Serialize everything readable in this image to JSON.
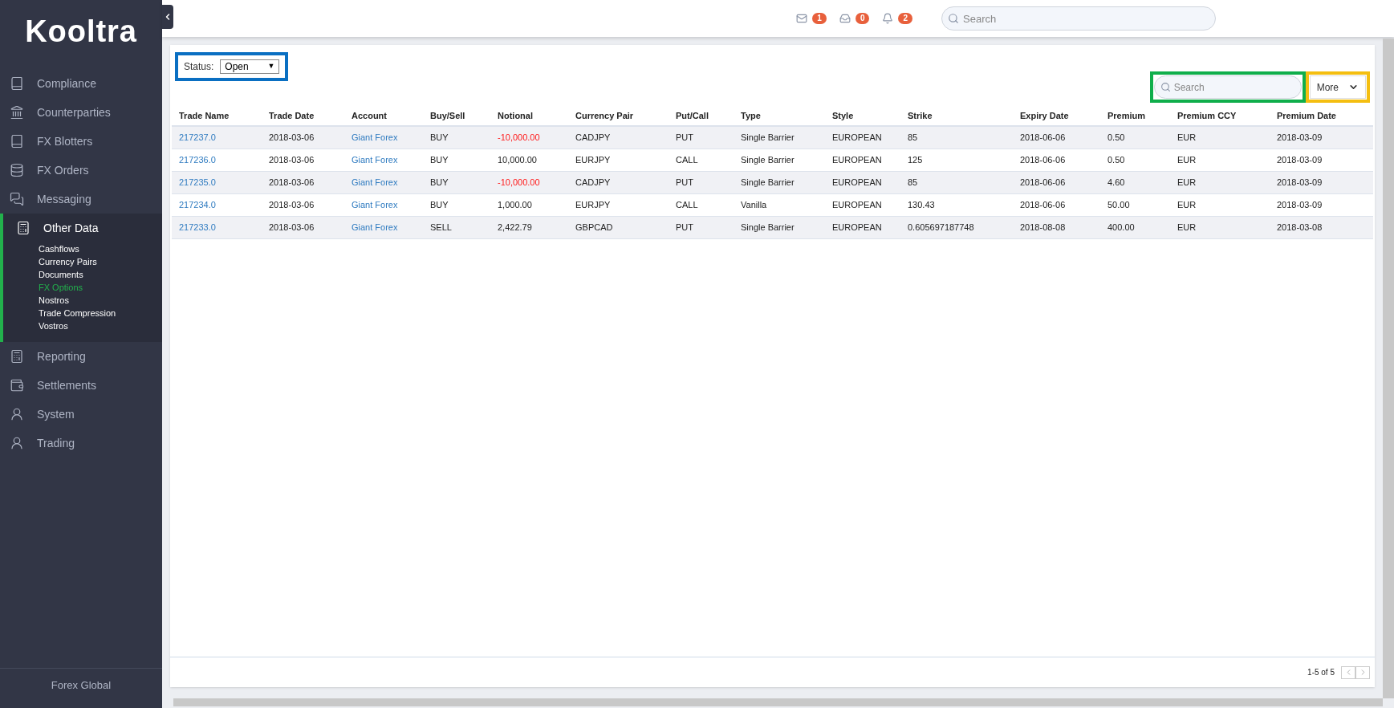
{
  "sidebar": {
    "logo": "Kooltra",
    "items": [
      {
        "label": "Compliance",
        "selected": false
      },
      {
        "label": "Counterparties",
        "selected": false
      },
      {
        "label": "FX Blotters",
        "selected": false
      },
      {
        "label": "FX Orders",
        "selected": false
      },
      {
        "label": "Messaging",
        "selected": false
      },
      {
        "label": "Other Data",
        "selected": true,
        "expanded": true,
        "children": [
          {
            "label": "Cashflows",
            "selected": false
          },
          {
            "label": "Currency Pairs",
            "selected": false
          },
          {
            "label": "Documents",
            "selected": false
          },
          {
            "label": "FX Options",
            "selected": true
          },
          {
            "label": "Nostros",
            "selected": false
          },
          {
            "label": "Trade Compression",
            "selected": false
          },
          {
            "label": "Vostros",
            "selected": false
          }
        ]
      },
      {
        "label": "Reporting",
        "selected": false
      },
      {
        "label": "Settlements",
        "selected": false
      },
      {
        "label": "System",
        "selected": false
      },
      {
        "label": "Trading",
        "selected": false
      }
    ],
    "footer": "Forex Global"
  },
  "topbar": {
    "notifications": [
      {
        "count": "1"
      },
      {
        "count": "0"
      },
      {
        "count": "2"
      }
    ],
    "search": {
      "placeholder": "Search"
    }
  },
  "filter": {
    "label": "Status:",
    "value": "Open",
    "arrow": "▼"
  },
  "table_search": {
    "placeholder": "Search"
  },
  "more_button": "More",
  "table": {
    "columns": [
      "Trade Name",
      "Trade Date",
      "Account",
      "Buy/Sell",
      "Notional",
      "Currency Pair",
      "Put/Call",
      "Type",
      "Style",
      "Strike",
      "Expiry Date",
      "Premium",
      "Premium CCY",
      "Premium Date"
    ],
    "rows": [
      [
        {
          "text": "217237.0",
          "kind": "link"
        },
        {
          "text": "2018-03-06",
          "kind": "text"
        },
        {
          "text": "Giant Forex",
          "kind": "link"
        },
        {
          "text": "BUY",
          "kind": "text"
        },
        {
          "text": "-10,000.00",
          "kind": "negative"
        },
        {
          "text": "CADJPY",
          "kind": "text"
        },
        {
          "text": "PUT",
          "kind": "text"
        },
        {
          "text": "Single Barrier",
          "kind": "text"
        },
        {
          "text": "EUROPEAN",
          "kind": "text"
        },
        {
          "text": "85",
          "kind": "text"
        },
        {
          "text": "2018-06-06",
          "kind": "text"
        },
        {
          "text": "0.50",
          "kind": "text"
        },
        {
          "text": "EUR",
          "kind": "text"
        },
        {
          "text": "2018-03-09",
          "kind": "text"
        }
      ],
      [
        {
          "text": "217236.0",
          "kind": "link"
        },
        {
          "text": "2018-03-06",
          "kind": "text"
        },
        {
          "text": "Giant Forex",
          "kind": "link"
        },
        {
          "text": "BUY",
          "kind": "text"
        },
        {
          "text": "10,000.00",
          "kind": "text"
        },
        {
          "text": "EURJPY",
          "kind": "text"
        },
        {
          "text": "CALL",
          "kind": "text"
        },
        {
          "text": "Single Barrier",
          "kind": "text"
        },
        {
          "text": "EUROPEAN",
          "kind": "text"
        },
        {
          "text": "125",
          "kind": "text"
        },
        {
          "text": "2018-06-06",
          "kind": "text"
        },
        {
          "text": "0.50",
          "kind": "text"
        },
        {
          "text": "EUR",
          "kind": "text"
        },
        {
          "text": "2018-03-09",
          "kind": "text"
        }
      ],
      [
        {
          "text": "217235.0",
          "kind": "link"
        },
        {
          "text": "2018-03-06",
          "kind": "text"
        },
        {
          "text": "Giant Forex",
          "kind": "link"
        },
        {
          "text": "BUY",
          "kind": "text"
        },
        {
          "text": "-10,000.00",
          "kind": "negative"
        },
        {
          "text": "CADJPY",
          "kind": "text"
        },
        {
          "text": "PUT",
          "kind": "text"
        },
        {
          "text": "Single Barrier",
          "kind": "text"
        },
        {
          "text": "EUROPEAN",
          "kind": "text"
        },
        {
          "text": "85",
          "kind": "text"
        },
        {
          "text": "2018-06-06",
          "kind": "text"
        },
        {
          "text": "4.60",
          "kind": "text"
        },
        {
          "text": "EUR",
          "kind": "text"
        },
        {
          "text": "2018-03-09",
          "kind": "text"
        }
      ],
      [
        {
          "text": "217234.0",
          "kind": "link"
        },
        {
          "text": "2018-03-06",
          "kind": "text"
        },
        {
          "text": "Giant Forex",
          "kind": "link"
        },
        {
          "text": "BUY",
          "kind": "text"
        },
        {
          "text": "1,000.00",
          "kind": "text"
        },
        {
          "text": "EURJPY",
          "kind": "text"
        },
        {
          "text": "CALL",
          "kind": "text"
        },
        {
          "text": "Vanilla",
          "kind": "text"
        },
        {
          "text": "EUROPEAN",
          "kind": "text"
        },
        {
          "text": "130.43",
          "kind": "text"
        },
        {
          "text": "2018-06-06",
          "kind": "text"
        },
        {
          "text": "50.00",
          "kind": "text"
        },
        {
          "text": "EUR",
          "kind": "text"
        },
        {
          "text": "2018-03-09",
          "kind": "text"
        }
      ],
      [
        {
          "text": "217233.0",
          "kind": "link"
        },
        {
          "text": "2018-03-06",
          "kind": "text"
        },
        {
          "text": "Giant Forex",
          "kind": "link"
        },
        {
          "text": "SELL",
          "kind": "text"
        },
        {
          "text": "2,422.79",
          "kind": "text"
        },
        {
          "text": "GBPCAD",
          "kind": "text"
        },
        {
          "text": "PUT",
          "kind": "text"
        },
        {
          "text": "Single Barrier",
          "kind": "text"
        },
        {
          "text": "EUROPEAN",
          "kind": "text"
        },
        {
          "text": "0.605697187748",
          "kind": "text"
        },
        {
          "text": "2018-08-08",
          "kind": "text"
        },
        {
          "text": "400.00",
          "kind": "text"
        },
        {
          "text": "EUR",
          "kind": "text"
        },
        {
          "text": "2018-03-08",
          "kind": "text"
        }
      ]
    ]
  },
  "pagination": {
    "summary": "1-5 of 5"
  }
}
